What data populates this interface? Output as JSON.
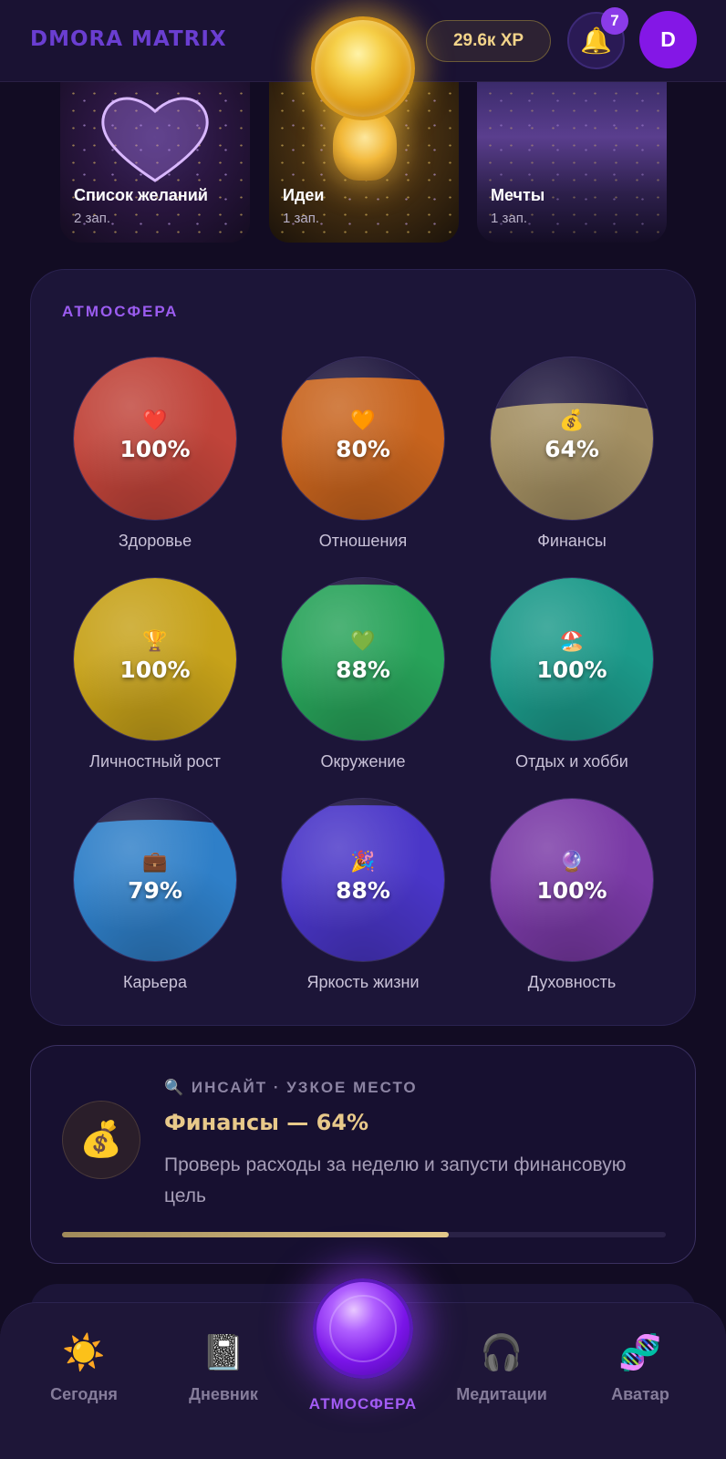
{
  "header": {
    "brand": "DMORA MATRIX",
    "xp": "29.6к XP",
    "notifications_count": "7",
    "avatar_letter": "D"
  },
  "categories": [
    {
      "title": "Список желаний",
      "count": "2 зап."
    },
    {
      "title": "Идеи",
      "count": "1 зап."
    },
    {
      "title": "Мечты",
      "count": "1 зап."
    }
  ],
  "atmosphere": {
    "label": "АТМОСФЕРА",
    "spheres": [
      {
        "name": "Здоровье",
        "percent": "100%",
        "value": 100,
        "emoji": "❤️",
        "color": "#c0443a"
      },
      {
        "name": "Отношения",
        "percent": "80%",
        "value": 80,
        "emoji": "🧡",
        "color": "#c8641e"
      },
      {
        "name": "Финансы",
        "percent": "64%",
        "value": 64,
        "emoji": "💰",
        "color": "#a38f62"
      },
      {
        "name": "Личностный рост",
        "percent": "100%",
        "value": 100,
        "emoji": "🏆",
        "color": "#c7a21a"
      },
      {
        "name": "Окружение",
        "percent": "88%",
        "value": 88,
        "emoji": "💚",
        "color": "#28a35a"
      },
      {
        "name": "Отдых и хобби",
        "percent": "100%",
        "value": 100,
        "emoji": "🏖️",
        "color": "#1c9a8a"
      },
      {
        "name": "Карьера",
        "percent": "79%",
        "value": 79,
        "emoji": "💼",
        "color": "#2f7fc8"
      },
      {
        "name": "Яркость жизни",
        "percent": "88%",
        "value": 88,
        "emoji": "🎉",
        "color": "#4a36c8"
      },
      {
        "name": "Духовность",
        "percent": "100%",
        "value": 100,
        "emoji": "🔮",
        "color": "#7a3aa6"
      }
    ]
  },
  "insight": {
    "icon": "💰",
    "kicker": "🔍 ИНСАЙТ · УЗКОЕ МЕСТО",
    "title": "Финансы — 64%",
    "text": "Проверь расходы за неделю и запусти финансовую цель",
    "progress": 0.64
  },
  "nav": {
    "items": [
      {
        "label": "Сегодня",
        "icon": "☀️"
      },
      {
        "label": "Дневник",
        "icon": "📓"
      },
      {
        "label": "Медитации",
        "icon": "🎧"
      },
      {
        "label": "Аватар",
        "icon": "🧬"
      }
    ],
    "active_label": "АТМОСФЕРА"
  }
}
